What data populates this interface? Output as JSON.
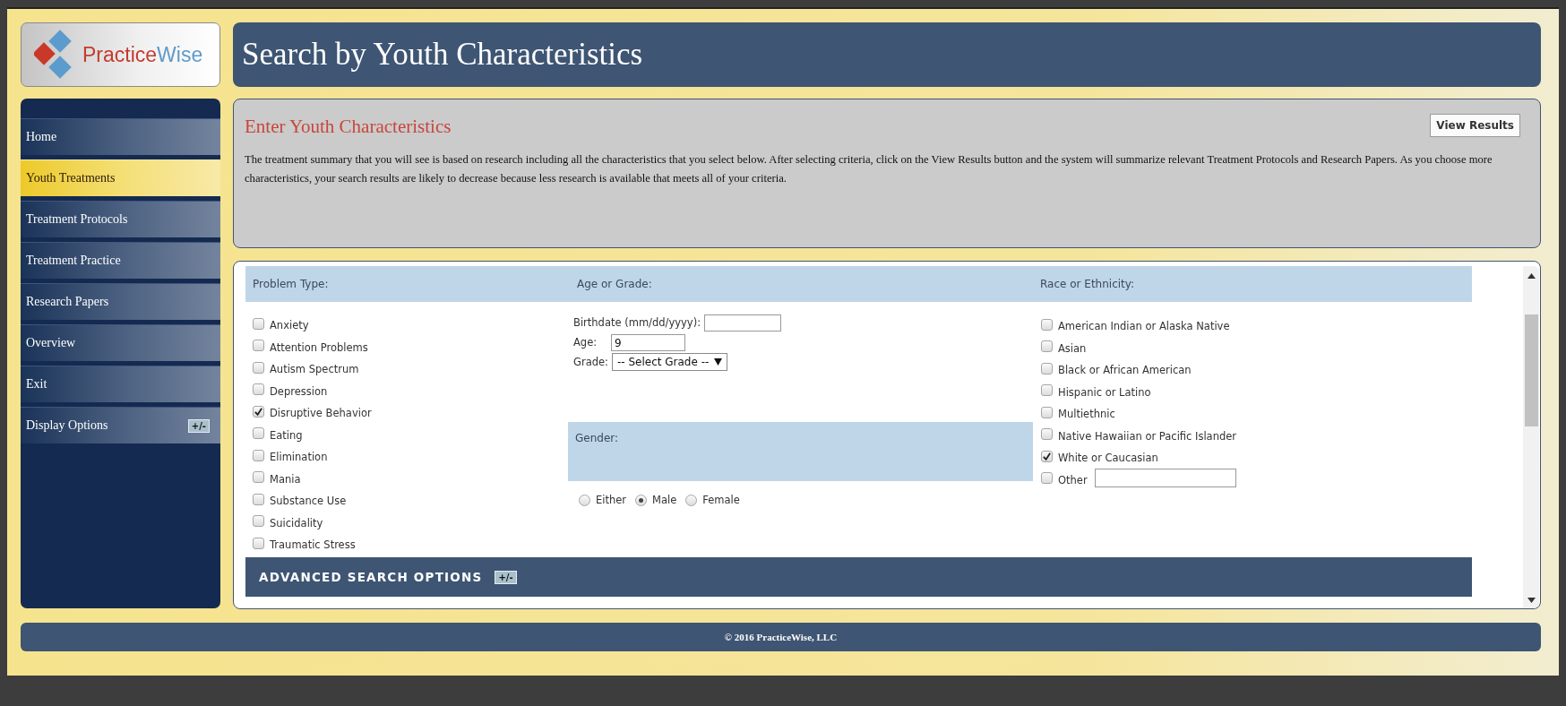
{
  "logo": {
    "primary": "Practice",
    "secondary": "Wise"
  },
  "header": {
    "title": "Search by Youth Characteristics"
  },
  "sidebar": {
    "items": [
      {
        "label": "Home",
        "selected": false
      },
      {
        "label": "Youth Treatments",
        "selected": true
      },
      {
        "label": "Treatment Protocols",
        "selected": false
      },
      {
        "label": "Treatment Practice",
        "selected": false
      },
      {
        "label": "Research Papers",
        "selected": false
      },
      {
        "label": "Overview",
        "selected": false
      },
      {
        "label": "Exit",
        "selected": false
      },
      {
        "label": "Display Options",
        "selected": false,
        "toggle": "+/-"
      }
    ]
  },
  "intro": {
    "heading": "Enter Youth Characteristics",
    "button": "View Results",
    "text": "The treatment summary that you will see is based on research including all the characteristics that you select below. After selecting criteria, click on the View Results button and the system will summarize relevant Treatment Protocols and Research Papers. As you choose more characteristics, your search results are likely to decrease because less research is available that meets all of your criteria."
  },
  "form": {
    "problem_type": {
      "label": "Problem Type:",
      "options": [
        {
          "label": "Anxiety",
          "checked": false
        },
        {
          "label": "Attention Problems",
          "checked": false
        },
        {
          "label": "Autism Spectrum",
          "checked": false
        },
        {
          "label": "Depression",
          "checked": false
        },
        {
          "label": "Disruptive Behavior",
          "checked": true
        },
        {
          "label": "Eating",
          "checked": false
        },
        {
          "label": "Elimination",
          "checked": false
        },
        {
          "label": "Mania",
          "checked": false
        },
        {
          "label": "Substance Use",
          "checked": false
        },
        {
          "label": "Suicidality",
          "checked": false
        },
        {
          "label": "Traumatic Stress",
          "checked": false
        }
      ]
    },
    "age_or_grade": {
      "label": "Age or Grade:",
      "birthdate_label": "Birthdate (mm/dd/yyyy):",
      "age_label": "Age:",
      "age_value": "9",
      "grade_label": "Grade:",
      "grade_value": "-- Select Grade --"
    },
    "gender": {
      "label": "Gender:",
      "options": [
        {
          "label": "Either",
          "selected": false
        },
        {
          "label": "Male",
          "selected": true
        },
        {
          "label": "Female",
          "selected": false
        }
      ]
    },
    "race": {
      "label": "Race or Ethnicity:",
      "options": [
        {
          "label": "American Indian or Alaska Native",
          "checked": false
        },
        {
          "label": "Asian",
          "checked": false
        },
        {
          "label": "Black or African American",
          "checked": false
        },
        {
          "label": "Hispanic or Latino",
          "checked": false
        },
        {
          "label": "Multiethnic",
          "checked": false
        },
        {
          "label": "Native Hawaiian or Pacific Islander",
          "checked": false
        },
        {
          "label": "White or Caucasian",
          "checked": true
        }
      ],
      "other": {
        "label": "Other",
        "checked": false
      }
    },
    "advanced": {
      "label": "ADVANCED SEARCH OPTIONS",
      "toggle": "+/-"
    }
  },
  "footer": {
    "text": "© 2016 PracticeWise, LLC"
  }
}
